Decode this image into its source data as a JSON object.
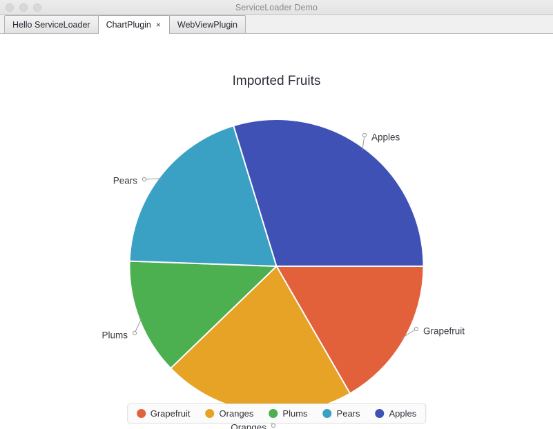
{
  "window": {
    "title": "ServiceLoader Demo",
    "traffic_lights": [
      "close",
      "minimize",
      "maximize"
    ]
  },
  "tabs": [
    {
      "label": "Hello ServiceLoader",
      "selected": false,
      "closable": false
    },
    {
      "label": "ChartPlugin",
      "selected": true,
      "closable": true,
      "close_glyph": "×"
    },
    {
      "label": "WebViewPlugin",
      "selected": false,
      "closable": false
    }
  ],
  "chart_data": {
    "type": "pie",
    "title": "Imported Fruits",
    "legend_position": "bottom",
    "start_angle_deg": 0,
    "direction": "clockwise",
    "categories": [
      "Grapefruit",
      "Oranges",
      "Plums",
      "Pears",
      "Apples"
    ],
    "values": [
      13,
      21,
      13,
      20,
      30
    ],
    "angles_deg": [
      60,
      76,
      46,
      71,
      107
    ],
    "colors": [
      "#e2603a",
      "#e6a325",
      "#4caf50",
      "#3aa0c4",
      "#3f51b5"
    ],
    "labels": [
      "Grapefruit",
      "Oranges",
      "Plums",
      "Pears",
      "Apples"
    ],
    "legend": [
      {
        "label": "Grapefruit",
        "color": "#e2603a"
      },
      {
        "label": "Oranges",
        "color": "#e6a325"
      },
      {
        "label": "Plums",
        "color": "#4caf50"
      },
      {
        "label": "Pears",
        "color": "#3aa0c4"
      },
      {
        "label": "Apples",
        "color": "#3f51b5"
      }
    ]
  }
}
